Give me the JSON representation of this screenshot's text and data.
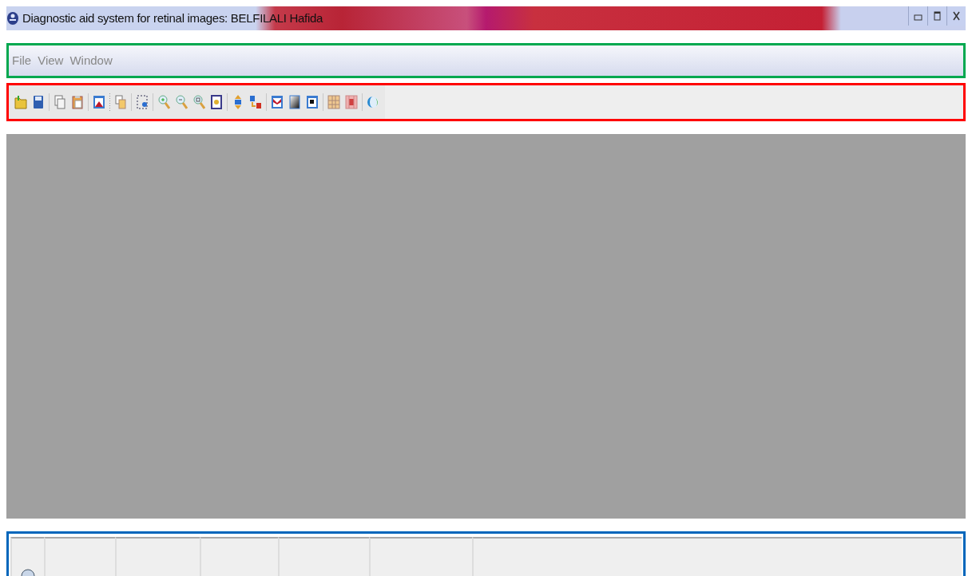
{
  "window": {
    "title": "Diagnostic aid system for retinal images: BELFILALI Hafida"
  },
  "menu": [
    {
      "label": "File"
    },
    {
      "label": "View"
    },
    {
      "label": "Window"
    }
  ]
}
